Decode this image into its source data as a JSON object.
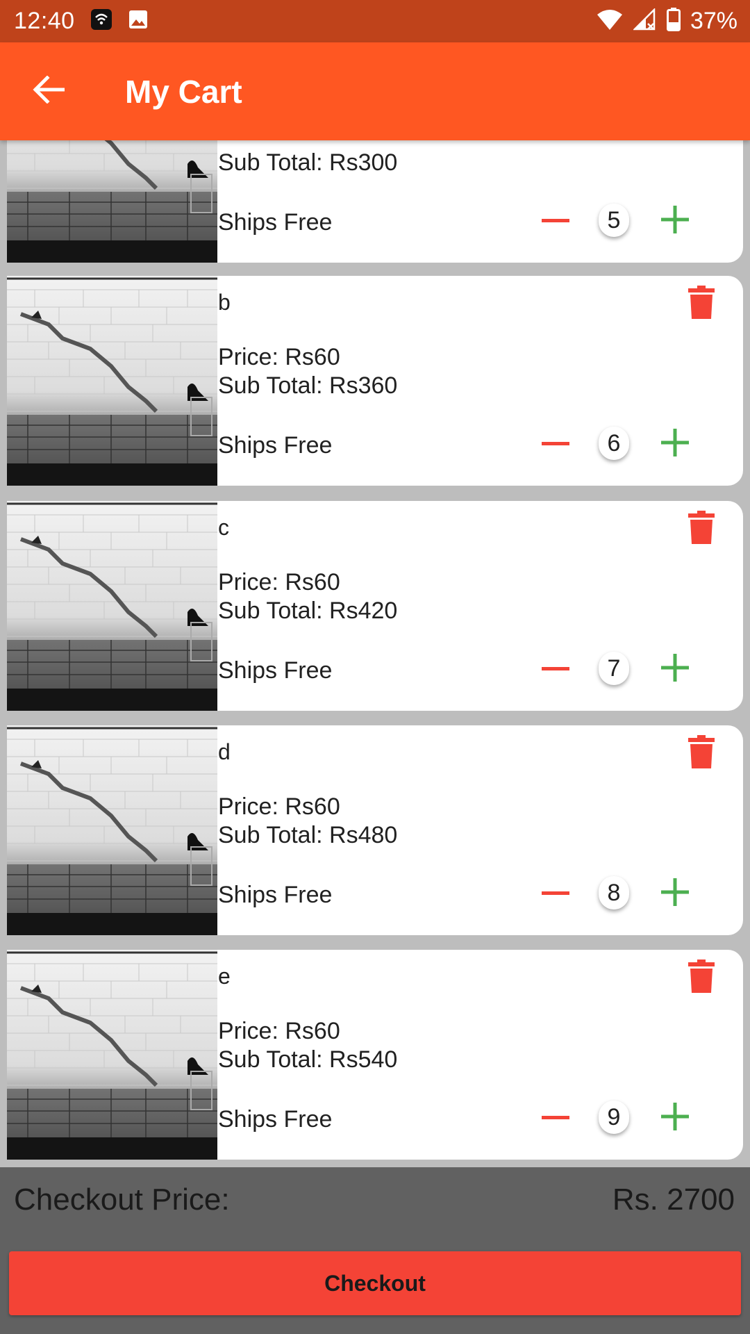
{
  "status_bar": {
    "time": "12:40",
    "battery": "37%",
    "icons": [
      "wifi-calling-icon",
      "image-icon",
      "wifi-icon",
      "signal-icon",
      "battery-icon"
    ]
  },
  "app_bar": {
    "title": "My Cart",
    "back_icon": "arrow-back-icon"
  },
  "cart": {
    "items": [
      {
        "name": "",
        "price": "",
        "subtotal": "Sub Total: Rs300",
        "shipping": "Ships Free",
        "quantity": "5"
      },
      {
        "name": "b",
        "price": "Price: Rs60",
        "subtotal": "Sub Total: Rs360",
        "shipping": "Ships Free",
        "quantity": "6"
      },
      {
        "name": "c",
        "price": "Price: Rs60",
        "subtotal": "Sub Total: Rs420",
        "shipping": "Ships Free",
        "quantity": "7"
      },
      {
        "name": "d",
        "price": "Price: Rs60",
        "subtotal": "Sub Total: Rs480",
        "shipping": "Ships Free",
        "quantity": "8"
      },
      {
        "name": "e",
        "price": "Price: Rs60",
        "subtotal": "Sub Total: Rs540",
        "shipping": "Ships Free",
        "quantity": "9"
      }
    ]
  },
  "checkout": {
    "label": "Checkout Price:",
    "value": "Rs. 2700",
    "button_label": "Checkout"
  },
  "colors": {
    "status_bar": "#bf431b",
    "app_bar": "#ff5722",
    "delete": "#f44336",
    "increment": "#4caf50",
    "checkout_button": "#f44336",
    "bottom_bar": "#616161"
  }
}
